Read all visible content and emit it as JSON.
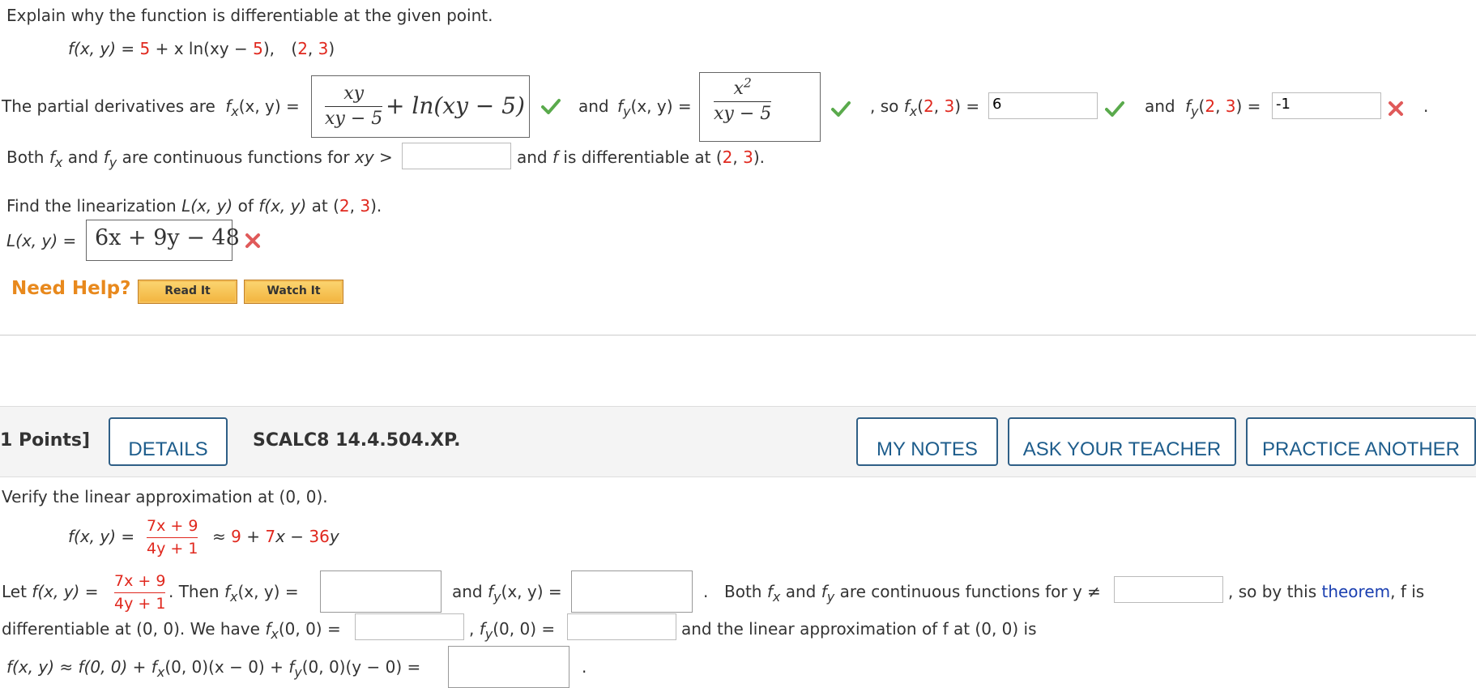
{
  "q1": {
    "prompt": "Explain why the function is differentiable at the given point.",
    "function": {
      "lhs": "f(x, y) = ",
      "part1": "5",
      "op1": " + x ln(xy − ",
      "part2": "5",
      "op2": "),",
      "point_open": "(",
      "px": "2",
      "comma": ", ",
      "py": "3",
      "point_close": ")"
    },
    "partials": {
      "intro": "The partial derivatives are",
      "fx_label": "f",
      "fx_sub": "x",
      "fx_args": "(x, y) =",
      "fx_num": "xy",
      "fx_den": "xy − 5",
      "fx_rest": "+ ln(xy − 5)",
      "and1": "and",
      "fy_label": "f",
      "fy_sub": "y",
      "fy_args": "(x, y) =",
      "fy_num_base": "x",
      "fy_num_exp": "2",
      "fy_den": "xy − 5",
      "so": ", so",
      "fx23_label": "f",
      "fx23_sub": "x",
      "fx23_open": "(",
      "fx23_a": "2",
      "fx23_comma": ", ",
      "fx23_b": "3",
      "fx23_close": ") =",
      "fx23_value": "6",
      "and2": "and",
      "fy23_label": "f",
      "fy23_sub": "y",
      "fy23_open": "(",
      "fy23_a": "2",
      "fy23_comma": ", ",
      "fy23_b": "3",
      "fy23_close": ") =",
      "fy23_value": "-1",
      "period": "."
    },
    "continuity": {
      "both": "Both",
      "fx": "f",
      "fx_sub": "x",
      "and": "and",
      "fy": "f",
      "fy_sub": "y",
      "text": "are continuous functions for",
      "xy_gt": "xy >",
      "value": "",
      "after": "and",
      "f": "f",
      "diff_text": "is differentiable at (",
      "a": "2",
      "comma": ", ",
      "b": "3",
      "close": ")."
    },
    "linearization": {
      "prompt_pre": "Find the linearization",
      "L": "L(x, y)",
      "of": "of",
      "f": "f(x, y)",
      "at": "at (",
      "a": "2",
      "comma": ", ",
      "b": "3",
      "close": ").",
      "label": "L(x, y) =",
      "answer": "6x + 9y − 48"
    },
    "help": {
      "label": "Need Help?",
      "read_it": "Read It",
      "watch_it": "Watch It"
    }
  },
  "header2": {
    "points": "1 Points]",
    "details": "DETAILS",
    "code": "SCALC8 14.4.504.XP.",
    "my_notes": "MY NOTES",
    "ask_teacher": "ASK YOUR TEACHER",
    "practice": "PRACTICE ANOTHER"
  },
  "q2": {
    "prompt": "Verify the linear approximation at (0, 0).",
    "approx_lhs": "f(x, y) =",
    "frac_num": "7x + 9",
    "frac_den": "4y + 1",
    "approx_sym": "≈",
    "approx_rhs_a": "9",
    "approx_rhs_b": " + ",
    "approx_rhs_c": "7",
    "approx_rhs_d": "x − ",
    "approx_rhs_e": "36",
    "approx_rhs_f": "y",
    "let": "Let",
    "let_f": "f(x, y) =",
    "then": ". Then",
    "fx": "f",
    "fx_sub": "x",
    "fx_args": "(x, y) =",
    "fx_value": "",
    "and_fy": "and",
    "fy": "f",
    "fy_sub": "y",
    "fy_args": "(x, y) =",
    "fy_value": "",
    "dot": ".",
    "both": "Both",
    "b_fx": "f",
    "b_fx_sub": "x",
    "b_and": "and",
    "b_fy": "f",
    "b_fy_sub": "y",
    "cont_text": "are continuous functions for y ≠",
    "y_value": "",
    "comma_so": ",  so by this",
    "theorem": "theorem",
    "f_is": ", f is",
    "diff_at": "differentiable at (0, 0). We have",
    "fx00": "f",
    "fx00_sub": "x",
    "fx00_args": "(0, 0) =",
    "fx00_value": "",
    "fy00_pre": ",",
    "fy00": "f",
    "fy00_sub": "y",
    "fy00_args": "(0, 0) =",
    "fy00_value": "",
    "lin_text": "and the linear approximation of f at (0, 0) is",
    "final_lhs": "f(x, y) ≈ f(0, 0) + ",
    "final_fx": "f",
    "final_fx_sub": "x",
    "final_mid": "(0, 0)(x − 0) + ",
    "final_fy": "f",
    "final_fy_sub": "y",
    "final_end": "(0, 0)(y − 0) =",
    "final_value": "",
    "final_dot": "."
  }
}
